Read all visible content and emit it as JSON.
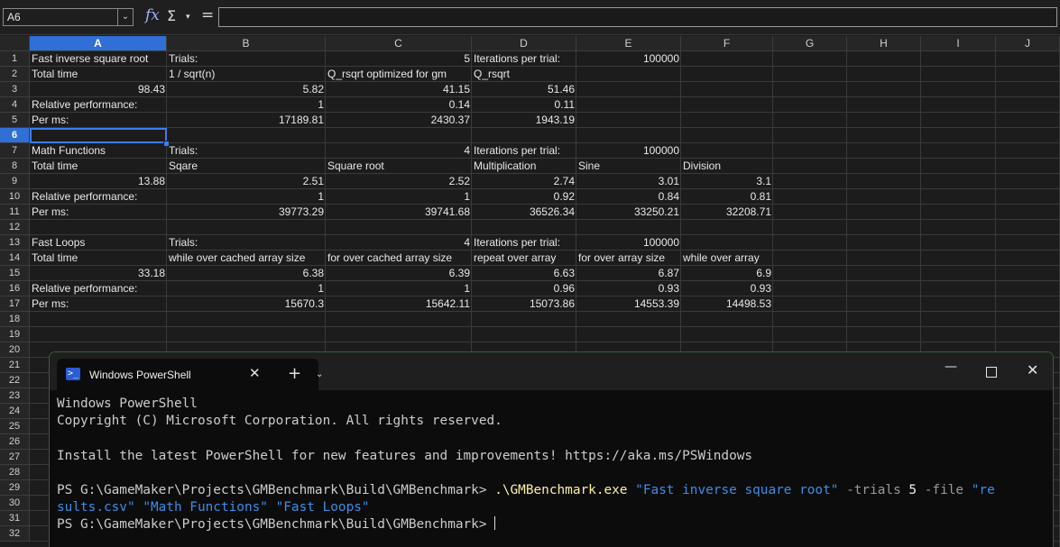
{
  "formula_bar": {
    "name_box": "A6",
    "name_box_arrow": "⌄",
    "fx_label": "fx",
    "sum_label": "Σ",
    "sum_dropdown": "▾",
    "equals_label": "=",
    "formula": ""
  },
  "columns": [
    "A",
    "B",
    "C",
    "D",
    "E",
    "F",
    "G",
    "H",
    "I",
    "J"
  ],
  "selected_column": "A",
  "selected_row": 6,
  "rows": [
    "1",
    "2",
    "3",
    "4",
    "5",
    "6",
    "7",
    "8",
    "9",
    "10",
    "11",
    "12",
    "13",
    "14",
    "15",
    "16",
    "17",
    "18",
    "19",
    "20",
    "21",
    "22",
    "23",
    "24",
    "25",
    "26",
    "27",
    "28",
    "29",
    "30",
    "31",
    "32"
  ],
  "cells": [
    {
      "col": "A",
      "row": 1,
      "v": "Fast inverse square root"
    },
    {
      "col": "B",
      "row": 1,
      "v": "Trials:"
    },
    {
      "col": "C",
      "row": 1,
      "v": "5",
      "num": true
    },
    {
      "col": "D",
      "row": 1,
      "v": "Iterations per trial:"
    },
    {
      "col": "E",
      "row": 1,
      "v": "100000",
      "num": true
    },
    {
      "col": "A",
      "row": 2,
      "v": "Total time"
    },
    {
      "col": "B",
      "row": 2,
      "v": "1 / sqrt(n)",
      "spell": true
    },
    {
      "col": "C",
      "row": 2,
      "v": "Q_rsqrt optimized for gm",
      "spell": true
    },
    {
      "col": "D",
      "row": 2,
      "v": "Q_rsqrt",
      "spell": true
    },
    {
      "col": "A",
      "row": 3,
      "v": "98.43",
      "num": true
    },
    {
      "col": "B",
      "row": 3,
      "v": "5.82",
      "num": true
    },
    {
      "col": "C",
      "row": 3,
      "v": "41.15",
      "num": true
    },
    {
      "col": "D",
      "row": 3,
      "v": "51.46",
      "num": true
    },
    {
      "col": "A",
      "row": 4,
      "v": "Relative performance:"
    },
    {
      "col": "B",
      "row": 4,
      "v": "1",
      "num": true
    },
    {
      "col": "C",
      "row": 4,
      "v": "0.14",
      "num": true
    },
    {
      "col": "D",
      "row": 4,
      "v": "0.11",
      "num": true
    },
    {
      "col": "A",
      "row": 5,
      "v": "Per ms:"
    },
    {
      "col": "B",
      "row": 5,
      "v": "17189.81",
      "num": true
    },
    {
      "col": "C",
      "row": 5,
      "v": "2430.37",
      "num": true
    },
    {
      "col": "D",
      "row": 5,
      "v": "1943.19",
      "num": true
    },
    {
      "col": "A",
      "row": 7,
      "v": "Math Functions"
    },
    {
      "col": "B",
      "row": 7,
      "v": "Trials:"
    },
    {
      "col": "C",
      "row": 7,
      "v": "4",
      "num": true
    },
    {
      "col": "D",
      "row": 7,
      "v": "Iterations per trial:"
    },
    {
      "col": "E",
      "row": 7,
      "v": "100000",
      "num": true
    },
    {
      "col": "A",
      "row": 8,
      "v": "Total time"
    },
    {
      "col": "B",
      "row": 8,
      "v": "Sqare",
      "spell": true
    },
    {
      "col": "C",
      "row": 8,
      "v": "Square root"
    },
    {
      "col": "D",
      "row": 8,
      "v": "Multiplication"
    },
    {
      "col": "E",
      "row": 8,
      "v": "Sine"
    },
    {
      "col": "F",
      "row": 8,
      "v": "Division"
    },
    {
      "col": "A",
      "row": 9,
      "v": "13.88",
      "num": true
    },
    {
      "col": "B",
      "row": 9,
      "v": "2.51",
      "num": true
    },
    {
      "col": "C",
      "row": 9,
      "v": "2.52",
      "num": true
    },
    {
      "col": "D",
      "row": 9,
      "v": "2.74",
      "num": true
    },
    {
      "col": "E",
      "row": 9,
      "v": "3.01",
      "num": true
    },
    {
      "col": "F",
      "row": 9,
      "v": "3.1",
      "num": true
    },
    {
      "col": "A",
      "row": 10,
      "v": "Relative performance:"
    },
    {
      "col": "B",
      "row": 10,
      "v": "1",
      "num": true
    },
    {
      "col": "C",
      "row": 10,
      "v": "1",
      "num": true
    },
    {
      "col": "D",
      "row": 10,
      "v": "0.92",
      "num": true
    },
    {
      "col": "E",
      "row": 10,
      "v": "0.84",
      "num": true
    },
    {
      "col": "F",
      "row": 10,
      "v": "0.81",
      "num": true
    },
    {
      "col": "A",
      "row": 11,
      "v": "Per ms:"
    },
    {
      "col": "B",
      "row": 11,
      "v": "39773.29",
      "num": true
    },
    {
      "col": "C",
      "row": 11,
      "v": "39741.68",
      "num": true
    },
    {
      "col": "D",
      "row": 11,
      "v": "36526.34",
      "num": true
    },
    {
      "col": "E",
      "row": 11,
      "v": "33250.21",
      "num": true
    },
    {
      "col": "F",
      "row": 11,
      "v": "32208.71",
      "num": true
    },
    {
      "col": "A",
      "row": 13,
      "v": "Fast Loops"
    },
    {
      "col": "B",
      "row": 13,
      "v": "Trials:"
    },
    {
      "col": "C",
      "row": 13,
      "v": "4",
      "num": true
    },
    {
      "col": "D",
      "row": 13,
      "v": "Iterations per trial:"
    },
    {
      "col": "E",
      "row": 13,
      "v": "100000",
      "num": true
    },
    {
      "col": "A",
      "row": 14,
      "v": "Total time"
    },
    {
      "col": "B",
      "row": 14,
      "v": "while over cached array size"
    },
    {
      "col": "C",
      "row": 14,
      "v": "for over cached array size"
    },
    {
      "col": "D",
      "row": 14,
      "v": "repeat over array"
    },
    {
      "col": "E",
      "row": 14,
      "v": "for over array size"
    },
    {
      "col": "F",
      "row": 14,
      "v": "while over array"
    },
    {
      "col": "A",
      "row": 15,
      "v": "33.18",
      "num": true
    },
    {
      "col": "B",
      "row": 15,
      "v": "6.38",
      "num": true
    },
    {
      "col": "C",
      "row": 15,
      "v": "6.39",
      "num": true
    },
    {
      "col": "D",
      "row": 15,
      "v": "6.63",
      "num": true
    },
    {
      "col": "E",
      "row": 15,
      "v": "6.87",
      "num": true
    },
    {
      "col": "F",
      "row": 15,
      "v": "6.9",
      "num": true
    },
    {
      "col": "A",
      "row": 16,
      "v": "Relative performance:"
    },
    {
      "col": "B",
      "row": 16,
      "v": "1",
      "num": true
    },
    {
      "col": "C",
      "row": 16,
      "v": "1",
      "num": true
    },
    {
      "col": "D",
      "row": 16,
      "v": "0.96",
      "num": true
    },
    {
      "col": "E",
      "row": 16,
      "v": "0.93",
      "num": true
    },
    {
      "col": "F",
      "row": 16,
      "v": "0.93",
      "num": true
    },
    {
      "col": "A",
      "row": 17,
      "v": "Per ms:"
    },
    {
      "col": "B",
      "row": 17,
      "v": "15670.3",
      "num": true
    },
    {
      "col": "C",
      "row": 17,
      "v": "15642.11",
      "num": true
    },
    {
      "col": "D",
      "row": 17,
      "v": "15073.86",
      "num": true
    },
    {
      "col": "E",
      "row": 17,
      "v": "14553.39",
      "num": true
    },
    {
      "col": "F",
      "row": 17,
      "v": "14498.53",
      "num": true
    }
  ],
  "terminal": {
    "tab_title": "Windows PowerShell",
    "tab_icon": ">_",
    "tab_close": "✕",
    "new_tab": "+",
    "tab_dropdown": "⌄",
    "minimize": "—",
    "close": "✕",
    "line1": "Windows PowerShell",
    "line2": "Copyright (C) Microsoft Corporation. All rights reserved.",
    "line3": "Install the latest PowerShell for new features and improvements! https://aka.ms/PSWindows",
    "prompt": "PS G:\\GameMaker\\Projects\\GMBenchmark\\Build\\GMBenchmark> ",
    "cmd_exe": ".\\GMBenchmark.exe",
    "cmd_arg1": "\"Fast inverse square root\"",
    "cmd_flag1": "-trials",
    "cmd_val1": "5",
    "cmd_flag2": "-file",
    "cmd_arg2a": "\"re",
    "cmd_arg2b": "sults.csv\"",
    "cmd_arg3": "\"Math Functions\"",
    "cmd_arg4": "\"Fast Loops\"",
    "prompt2": "PS G:\\GameMaker\\Projects\\GMBenchmark\\Build\\GMBenchmark> "
  }
}
